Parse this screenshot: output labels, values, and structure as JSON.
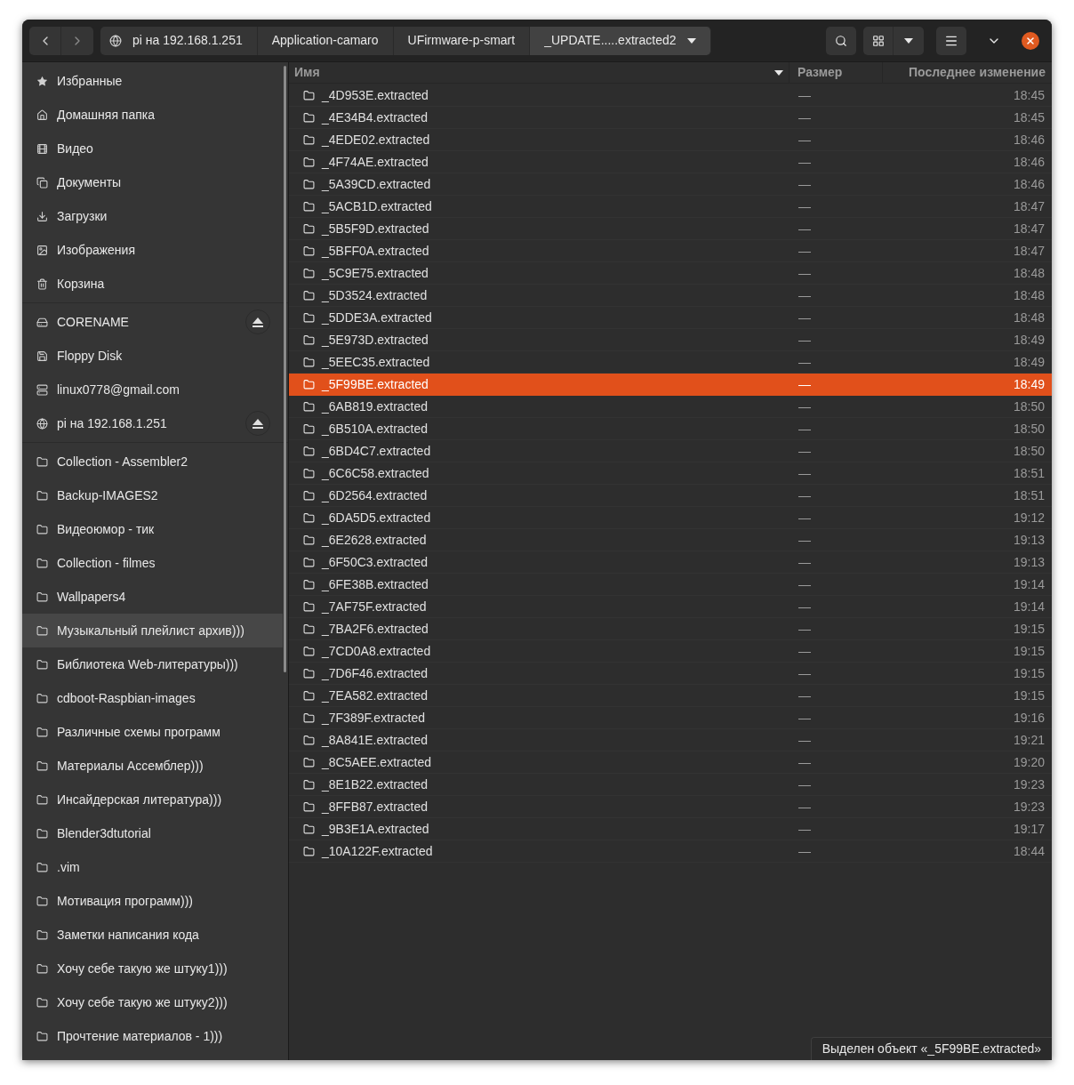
{
  "header": {
    "path": [
      {
        "label": "pi на 192.168.1.251",
        "kind": "network",
        "selected": false
      },
      {
        "label": "Application-camaro",
        "selected": false
      },
      {
        "label": "UFirmware-p-smart",
        "selected": false
      },
      {
        "label": "_UPDATE.....extracted2",
        "selected": true
      }
    ]
  },
  "sidebar": {
    "sections": [
      [
        {
          "label": "Избранные",
          "kind": "starred",
          "selected": false,
          "eject": false
        },
        {
          "label": "Домашняя папка",
          "kind": "home",
          "selected": false,
          "eject": false
        },
        {
          "label": "Видео",
          "kind": "video",
          "selected": false,
          "eject": false
        },
        {
          "label": "Документы",
          "kind": "documents",
          "selected": false,
          "eject": false
        },
        {
          "label": "Загрузки",
          "kind": "downloads",
          "selected": false,
          "eject": false
        },
        {
          "label": "Изображения",
          "kind": "pictures",
          "selected": false,
          "eject": false
        },
        {
          "label": "Корзина",
          "kind": "trash",
          "selected": false,
          "eject": false
        }
      ],
      [
        {
          "label": "CORENAME",
          "kind": "drive",
          "selected": false,
          "eject": true
        },
        {
          "label": "Floppy Disk",
          "kind": "floppy",
          "selected": false,
          "eject": false
        },
        {
          "label": "linux0778@gmail.com",
          "kind": "server",
          "selected": false,
          "eject": false
        },
        {
          "label": "pi на 192.168.1.251",
          "kind": "network",
          "selected": false,
          "eject": true
        }
      ],
      [
        {
          "label": "Collection - Assembler2",
          "kind": "folder",
          "selected": false,
          "eject": false
        },
        {
          "label": "Backup-IMAGES2",
          "kind": "folder",
          "selected": false,
          "eject": false
        },
        {
          "label": "Видеоюмор - тик",
          "kind": "folder",
          "selected": false,
          "eject": false
        },
        {
          "label": "Collection - filmes",
          "kind": "folder",
          "selected": false,
          "eject": false
        },
        {
          "label": "Wallpapers4",
          "kind": "folder",
          "selected": false,
          "eject": false
        },
        {
          "label": "Музыкальный плейлист архив)))",
          "kind": "folder",
          "selected": true,
          "eject": false
        },
        {
          "label": "Библиотека Web-литературы)))",
          "kind": "folder",
          "selected": false,
          "eject": false
        },
        {
          "label": "cdboot-Raspbian-images",
          "kind": "folder",
          "selected": false,
          "eject": false
        },
        {
          "label": "Различные схемы программ",
          "kind": "folder",
          "selected": false,
          "eject": false
        },
        {
          "label": "Материалы Ассемблер)))",
          "kind": "folder",
          "selected": false,
          "eject": false
        },
        {
          "label": "Инсайдерская литература)))",
          "kind": "folder",
          "selected": false,
          "eject": false
        },
        {
          "label": "Blender3dtutorial",
          "kind": "folder",
          "selected": false,
          "eject": false
        },
        {
          "label": ".vim",
          "kind": "folder",
          "selected": false,
          "eject": false
        },
        {
          "label": "Мотивация программ)))",
          "kind": "folder",
          "selected": false,
          "eject": false
        },
        {
          "label": "Заметки написания кода",
          "kind": "folder",
          "selected": false,
          "eject": false
        },
        {
          "label": "Хочу себе такую же штуку1)))",
          "kind": "folder",
          "selected": false,
          "eject": false
        },
        {
          "label": "Хочу себе такую же штуку2)))",
          "kind": "folder",
          "selected": false,
          "eject": false
        },
        {
          "label": "Прочтение материалов - 1)))",
          "kind": "folder",
          "selected": false,
          "eject": false
        }
      ]
    ]
  },
  "table": {
    "columns": [
      "Имя",
      "Размер",
      "Последнее изменение"
    ],
    "rows": [
      {
        "name": "_4D953E.extracted",
        "size": "—",
        "modified": "18:45",
        "selected": false
      },
      {
        "name": "_4E34B4.extracted",
        "size": "—",
        "modified": "18:45",
        "selected": false
      },
      {
        "name": "_4EDE02.extracted",
        "size": "—",
        "modified": "18:46",
        "selected": false
      },
      {
        "name": "_4F74AE.extracted",
        "size": "—",
        "modified": "18:46",
        "selected": false
      },
      {
        "name": "_5A39CD.extracted",
        "size": "—",
        "modified": "18:46",
        "selected": false
      },
      {
        "name": "_5ACB1D.extracted",
        "size": "—",
        "modified": "18:47",
        "selected": false
      },
      {
        "name": "_5B5F9D.extracted",
        "size": "—",
        "modified": "18:47",
        "selected": false
      },
      {
        "name": "_5BFF0A.extracted",
        "size": "—",
        "modified": "18:47",
        "selected": false
      },
      {
        "name": "_5C9E75.extracted",
        "size": "—",
        "modified": "18:48",
        "selected": false
      },
      {
        "name": "_5D3524.extracted",
        "size": "—",
        "modified": "18:48",
        "selected": false
      },
      {
        "name": "_5DDE3A.extracted",
        "size": "—",
        "modified": "18:48",
        "selected": false
      },
      {
        "name": "_5E973D.extracted",
        "size": "—",
        "modified": "18:49",
        "selected": false
      },
      {
        "name": "_5EEC35.extracted",
        "size": "—",
        "modified": "18:49",
        "selected": false
      },
      {
        "name": "_5F99BE.extracted",
        "size": "—",
        "modified": "18:49",
        "selected": true
      },
      {
        "name": "_6AB819.extracted",
        "size": "—",
        "modified": "18:50",
        "selected": false
      },
      {
        "name": "_6B510A.extracted",
        "size": "—",
        "modified": "18:50",
        "selected": false
      },
      {
        "name": "_6BD4C7.extracted",
        "size": "—",
        "modified": "18:50",
        "selected": false
      },
      {
        "name": "_6C6C58.extracted",
        "size": "—",
        "modified": "18:51",
        "selected": false
      },
      {
        "name": "_6D2564.extracted",
        "size": "—",
        "modified": "18:51",
        "selected": false
      },
      {
        "name": "_6DA5D5.extracted",
        "size": "—",
        "modified": "19:12",
        "selected": false
      },
      {
        "name": "_6E2628.extracted",
        "size": "—",
        "modified": "19:13",
        "selected": false
      },
      {
        "name": "_6F50C3.extracted",
        "size": "—",
        "modified": "19:13",
        "selected": false
      },
      {
        "name": "_6FE38B.extracted",
        "size": "—",
        "modified": "19:14",
        "selected": false
      },
      {
        "name": "_7AF75F.extracted",
        "size": "—",
        "modified": "19:14",
        "selected": false
      },
      {
        "name": "_7BA2F6.extracted",
        "size": "—",
        "modified": "19:15",
        "selected": false
      },
      {
        "name": "_7CD0A8.extracted",
        "size": "—",
        "modified": "19:15",
        "selected": false
      },
      {
        "name": "_7D6F46.extracted",
        "size": "—",
        "modified": "19:15",
        "selected": false
      },
      {
        "name": "_7EA582.extracted",
        "size": "—",
        "modified": "19:15",
        "selected": false
      },
      {
        "name": "_7F389F.extracted",
        "size": "—",
        "modified": "19:16",
        "selected": false
      },
      {
        "name": "_8A841E.extracted",
        "size": "—",
        "modified": "19:21",
        "selected": false
      },
      {
        "name": "_8C5AEE.extracted",
        "size": "—",
        "modified": "19:20",
        "selected": false
      },
      {
        "name": "_8E1B22.extracted",
        "size": "—",
        "modified": "19:23",
        "selected": false
      },
      {
        "name": "_8FFB87.extracted",
        "size": "—",
        "modified": "19:23",
        "selected": false
      },
      {
        "name": "_9B3E1A.extracted",
        "size": "—",
        "modified": "19:17",
        "selected": false
      },
      {
        "name": "_10A122F.extracted",
        "size": "—",
        "modified": "18:44",
        "selected": false
      }
    ]
  },
  "status_bar": {
    "text": "Выделен объект «_5F99BE.extracted»"
  }
}
